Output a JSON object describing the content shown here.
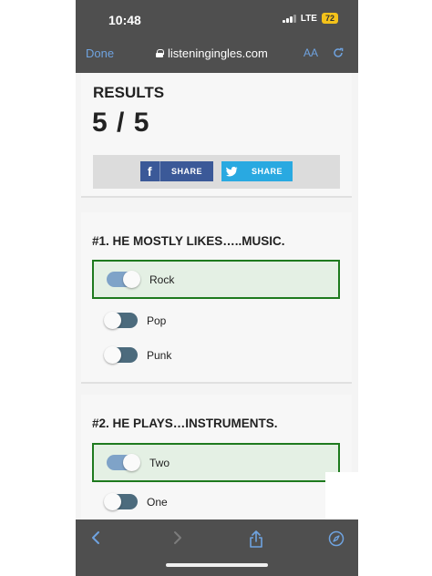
{
  "status_bar": {
    "time": "10:48",
    "network": "LTE",
    "battery": "72"
  },
  "browser": {
    "done_label": "Done",
    "url": "listeningingles.com",
    "text_size_label": "AA"
  },
  "results": {
    "title": "RESULTS",
    "score": "5 / 5"
  },
  "share": {
    "facebook_label": "SHARE",
    "twitter_label": "SHARE"
  },
  "questions": [
    {
      "title": "#1. HE MOSTLY LIKES…..MUSIC.",
      "options": [
        {
          "label": "Rock",
          "selected": true
        },
        {
          "label": "Pop",
          "selected": false
        },
        {
          "label": "Punk",
          "selected": false
        }
      ]
    },
    {
      "title": "#2. HE PLAYS…INSTRUMENTS.",
      "options": [
        {
          "label": "Two",
          "selected": true
        },
        {
          "label": "One",
          "selected": false
        }
      ]
    }
  ],
  "colors": {
    "correct_border": "#1e7a1e",
    "correct_fill": "#e4f0e4",
    "facebook": "#3b5998",
    "twitter": "#29a9e1",
    "link_blue": "#6fa3e0"
  }
}
